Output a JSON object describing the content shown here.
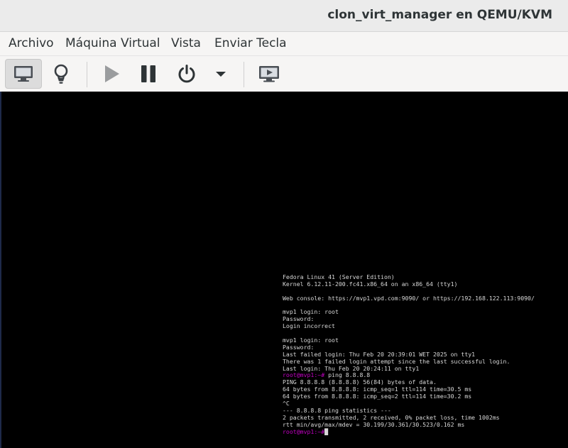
{
  "window": {
    "title": "clon_virt_manager en QEMU/KVM"
  },
  "menu": {
    "items": [
      {
        "label": "Archivo"
      },
      {
        "label": "Máquina Virtual"
      },
      {
        "label": "Vista"
      },
      {
        "label": "Enviar Tecla"
      }
    ]
  },
  "toolbar": {
    "buttons": [
      {
        "icon": "monitor-icon",
        "state": "active"
      },
      {
        "icon": "lightbulb-icon"
      },
      {
        "icon": "play-icon",
        "state": "disabled"
      },
      {
        "icon": "pause-icon"
      },
      {
        "icon": "power-icon"
      },
      {
        "icon": "dropdown-arrow-icon"
      },
      {
        "icon": "fullscreen-icon"
      }
    ]
  },
  "terminal": {
    "prompt": "root@mvp1:~#",
    "lines": [
      "Fedora Linux 41 (Server Edition)",
      "Kernel 6.12.11-200.fc41.x86_64 on an x86_64 (tty1)",
      "",
      "Web console: https://mvp1.vpd.com:9090/ or https://192.168.122.113:9090/",
      "",
      "mvp1 login: root",
      "Password:",
      "Login incorrect",
      "",
      "mvp1 login: root",
      "Password:",
      "Last failed login: Thu Feb 20 20:39:01 WET 2025 on tty1",
      "There was 1 failed login attempt since the last successful login.",
      "Last login: Thu Feb 20 20:24:11 on tty1",
      "",
      "PING 8.8.8.8 (8.8.8.8) 56(84) bytes of data.",
      "64 bytes from 8.8.8.8: icmp_seq=1 ttl=114 time=30.5 ms",
      "64 bytes from 8.8.8.8: icmp_seq=2 ttl=114 time=30.2 ms",
      "^C",
      "--- 8.8.8.8 ping statistics ---",
      "2 packets transmitted, 2 received, 0% packet loss, time 1002ms",
      "rtt min/avg/max/mdev = 30.199/30.361/30.523/0.162 ms",
      ""
    ],
    "command_ping": " ping 8.8.8.8",
    "cursor": "█"
  }
}
